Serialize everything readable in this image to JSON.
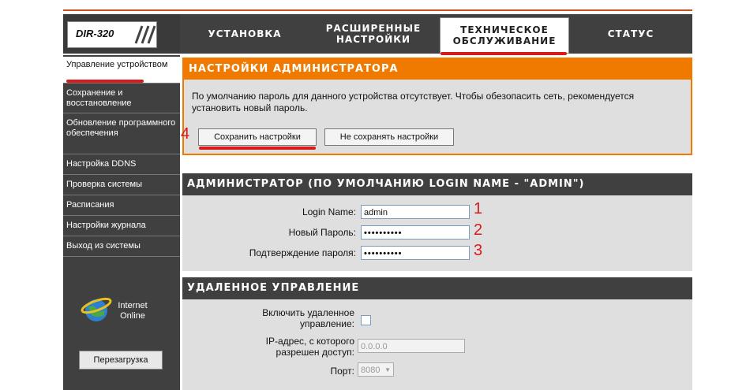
{
  "header": {
    "model": "DIR-320",
    "tabs": [
      {
        "label": "УСТАНОВКА"
      },
      {
        "label": "РАСШИРЕННЫЕ НАСТРОЙКИ"
      },
      {
        "label": "ТЕХНИЧЕСКОЕ ОБСЛУЖИВАНИЕ"
      },
      {
        "label": "СТАТУС"
      }
    ]
  },
  "sidebar": {
    "items": [
      {
        "label": "Управление устройством"
      },
      {
        "label": "Сохранение и восстановление"
      },
      {
        "label": "Обновление программного обеспечения"
      },
      {
        "label": "Настройка DDNS"
      },
      {
        "label": "Проверка системы"
      },
      {
        "label": "Расписания"
      },
      {
        "label": "Настройки журнала"
      },
      {
        "label": "Выход из системы"
      }
    ],
    "status": "Internet Online",
    "reboot": "Перезагрузка"
  },
  "admin_settings": {
    "title": "НАСТРОЙКИ АДМИНИСТРАТОРА",
    "description": "По умолчанию пароль для данного устройства отсутствует. Чтобы обезопасить сеть, рекомендуется установить новый пароль.",
    "save_label": "Сохранить настройки",
    "nosave_label": "Не сохранять настройки"
  },
  "administrator": {
    "title": "АДМИНИСТРАТОР (ПО УМОЛЧАНИЮ LOGIN NAME - \"ADMIN\")",
    "login_label": "Login Name:",
    "login_value": "admin",
    "password_label": "Новый Пароль:",
    "password_value": "••••••••••",
    "confirm_label": "Подтверждение пароля:",
    "confirm_value": "••••••••••"
  },
  "remote": {
    "title": "УДАЛЕННОЕ УПРАВЛЕНИЕ",
    "enable_label": "Включить удаленное управление:",
    "ip_label": "IP-адрес, с которого разрешен доступ:",
    "ip_value": "0.0.0.0",
    "port_label": "Порт:",
    "port_value": "8080"
  },
  "annotations": {
    "n1": "1",
    "n2": "2",
    "n3": "3",
    "n4": "4"
  },
  "colors": {
    "accent": "#f07a00",
    "dark": "#404040",
    "annotation": "#d81a1a"
  }
}
